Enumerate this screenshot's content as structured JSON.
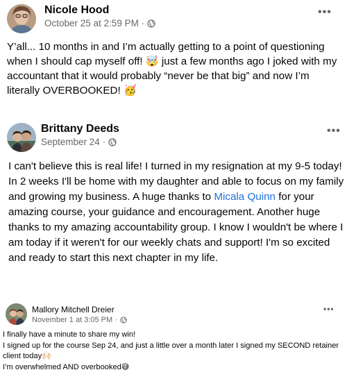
{
  "posts": [
    {
      "author": "Nicole Hood",
      "timestamp": "October 25 at 2:59 PM",
      "privacy_icon": "globe-icon",
      "more_label": "•••",
      "body": "Y’all... 10 months in and I’m actually getting to a point of questioning when I should cap myself off! 🤯 just a few months ago I joked with my accountant that it would probably “never be that big” and now I’m literally OVERBOOKED! 🥳"
    },
    {
      "author": "Brittany Deeds",
      "timestamp": "September 24",
      "privacy_icon": "globe-icon",
      "more_label": "•••",
      "body_before": "I can't believe this is real life! I turned in my resignation at my 9-5 today! In 2 weeks I'll be home with my daughter and able to focus on my family and growing my business. A huge thanks to ",
      "mention": "Micala Quinn",
      "body_after": " for your amazing course, your guidance and encouragement. Another huge thanks to my amazing accountability group. I know I wouldn't be where I am today if it weren't for our weekly chats and support! I'm so excited and ready to start this next chapter in my life."
    },
    {
      "author": "Mallory Mitchell Dreier",
      "timestamp": "November 1 at 3:05 PM",
      "privacy_icon": "globe-icon",
      "more_label": "•••",
      "body": "I finally have a minute to share my win!\nI signed up for the course Sep 24, and just a little over a month later I signed my SECOND retainer client today🙌🏻\nI’m overwhelmed AND overbooked😅"
    }
  ],
  "colors": {
    "text": "#050505",
    "meta": "#65676b",
    "mention": "#216fdb",
    "background": "#ffffff"
  }
}
